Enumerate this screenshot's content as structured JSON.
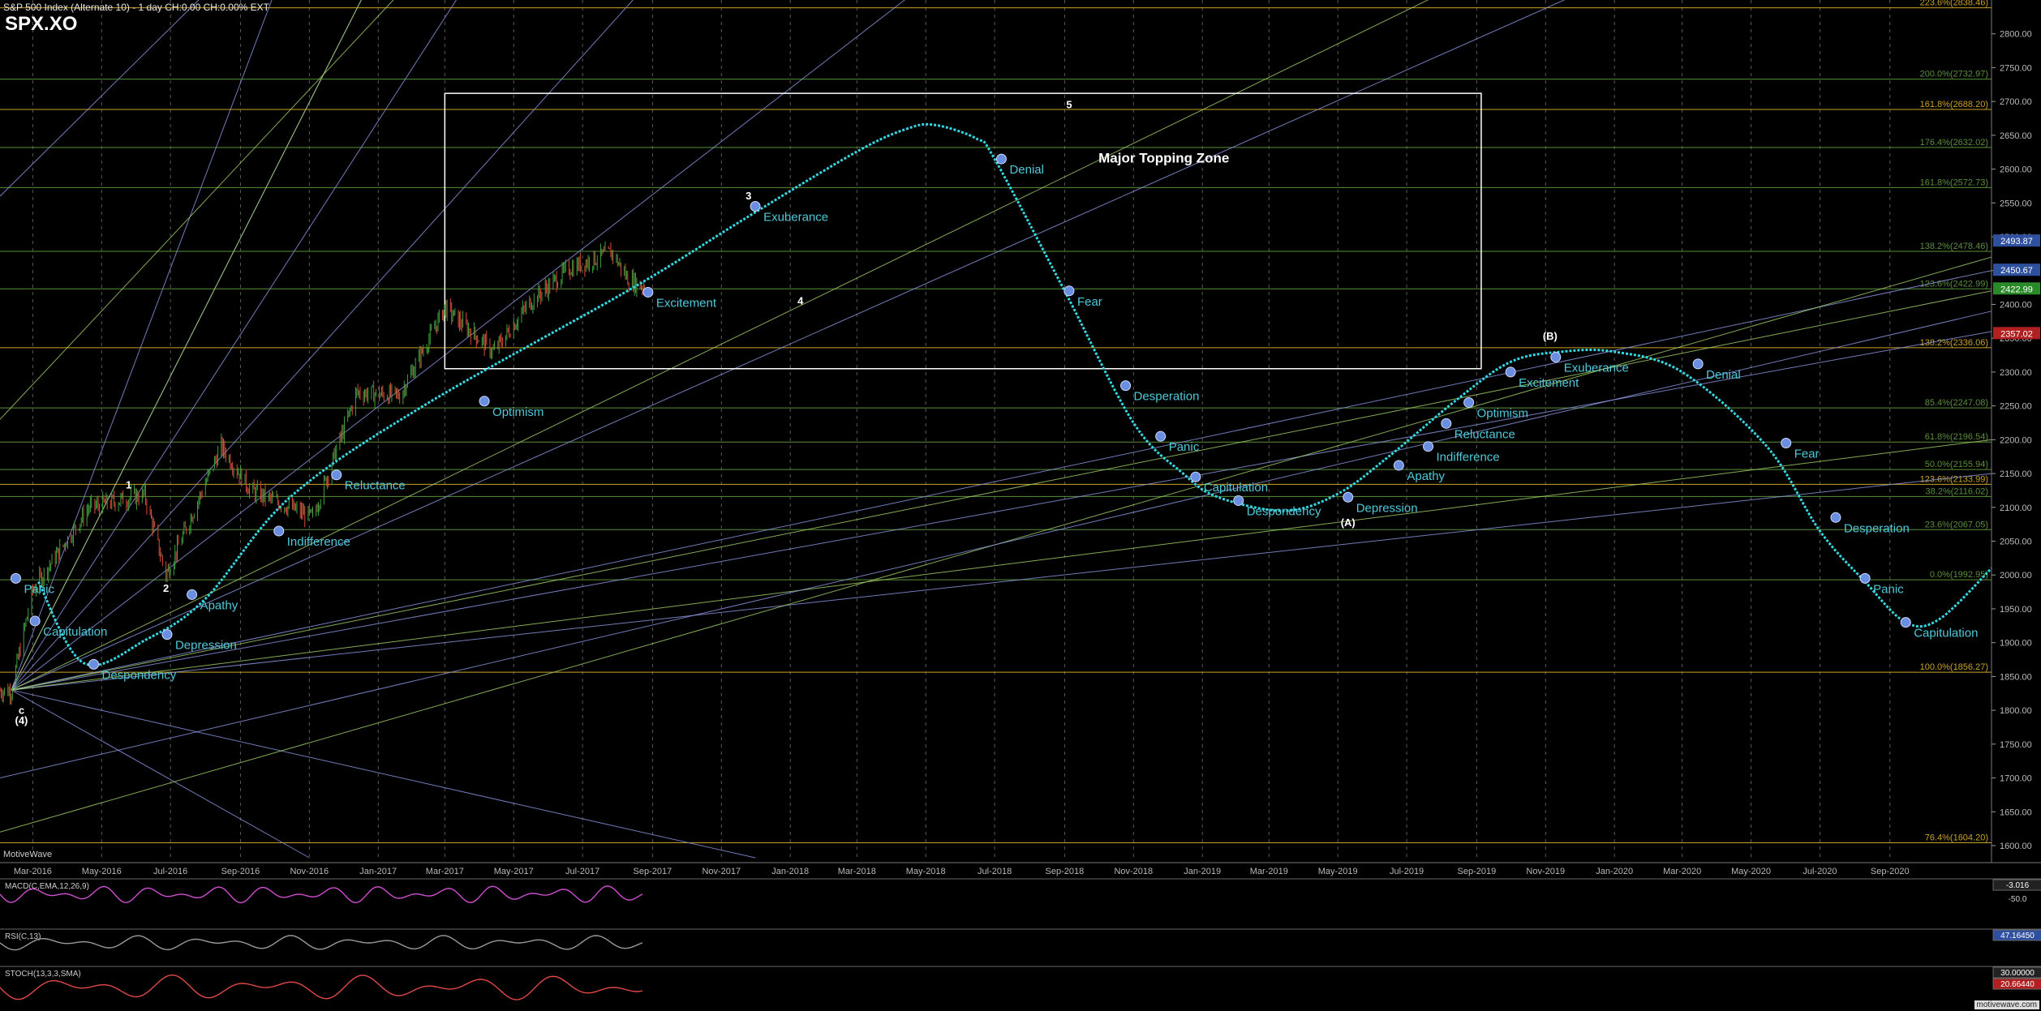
{
  "header": {
    "title": "S&P 500 Index (Alternate 10) - 1 day",
    "change": "CH:0.00",
    "change_pct": "CH:0.00%",
    "session": "EXT",
    "symbol": "SPX.XO"
  },
  "footer": {
    "source": "MotiveWave",
    "watermark": "motivewave.com"
  },
  "colors": {
    "background": "#000000",
    "projection": "#35d6e0",
    "fib_green": "#5a8f3a",
    "fib_gold": "#c9a227",
    "fan_blue": "#8f9be6",
    "fan_green": "#a6d66b",
    "price_green": "#3fa340",
    "price_red": "#d94a3a",
    "label_cyan": "#4fc9d9",
    "box": "#ffffff"
  },
  "chart_data": {
    "type": "line",
    "title": "S&P 500 Index (Alternate 10) - 1 day",
    "y_ticks": [
      "1600.00",
      "1650.00",
      "1700.00",
      "1750.00",
      "1800.00",
      "1850.00",
      "1900.00",
      "1950.00",
      "2000.00",
      "2050.00",
      "2100.00",
      "2150.00",
      "2200.00",
      "2250.00",
      "2300.00",
      "2350.00",
      "2400.00",
      "2450.00",
      "2500.00",
      "2550.00",
      "2600.00",
      "2650.00",
      "2700.00",
      "2750.00",
      "2800.00"
    ],
    "ylim": [
      1582,
      2850
    ],
    "x_ticks": [
      "Mar-2016",
      "May-2016",
      "Jul-2016",
      "Sep-2016",
      "Nov-2016",
      "Jan-2017",
      "Mar-2017",
      "May-2017",
      "Jul-2017",
      "Sep-2017",
      "Nov-2017",
      "Jan-2018",
      "Mar-2018",
      "May-2018",
      "Jul-2018",
      "Sep-2018",
      "Nov-2018",
      "Jan-2019",
      "Mar-2019",
      "May-2019",
      "Jul-2019",
      "Sep-2019",
      "Nov-2019",
      "Jan-2020",
      "Mar-2020",
      "May-2020",
      "Jul-2020",
      "Sep-2020"
    ],
    "fib_levels": [
      {
        "label": "223.6%(2838.46)",
        "value": 2838.46,
        "color": "gold"
      },
      {
        "label": "200.0%(2732.97)",
        "value": 2732.97,
        "color": "green"
      },
      {
        "label": "161.8%(2688.20)",
        "value": 2688.2,
        "color": "gold"
      },
      {
        "label": "176.4%(2632.02)",
        "value": 2632.02,
        "color": "green"
      },
      {
        "label": "161.8%(2572.73)",
        "value": 2572.73,
        "color": "green"
      },
      {
        "label": "138.2%(2478.46)",
        "value": 2478.46,
        "color": "green"
      },
      {
        "label": "123.6%(2422.99)",
        "value": 2422.99,
        "color": "green"
      },
      {
        "label": "138.2%(2336.06)",
        "value": 2336.06,
        "color": "gold"
      },
      {
        "label": "85.4%(2247.08)",
        "value": 2247.08,
        "color": "green"
      },
      {
        "label": "61.8%(2196.54)",
        "value": 2196.54,
        "color": "green"
      },
      {
        "label": "50.0%(2155.94)",
        "value": 2155.94,
        "color": "green"
      },
      {
        "label": "123.6%(2133.99)",
        "value": 2133.99,
        "color": "gold"
      },
      {
        "label": "38.2%(2116.02)",
        "value": 2116.02,
        "color": "green"
      },
      {
        "label": "23.6%(2067.05)",
        "value": 2067.05,
        "color": "green"
      },
      {
        "label": "0.0%(1992.95)",
        "value": 1992.95,
        "color": "green"
      },
      {
        "label": "100.0%(1856.27)",
        "value": 1856.27,
        "color": "gold"
      },
      {
        "label": "76.4%(1604.20)",
        "value": 1604.2,
        "color": "gold"
      }
    ],
    "price_tags": [
      {
        "label": "2493.87",
        "value": 2493.87,
        "color": "#2f4f9f"
      },
      {
        "label": "2450.67",
        "value": 2450.67,
        "color": "#2f4f9f"
      },
      {
        "label": "2422.99",
        "value": 2422.99,
        "color": "#2a8a2a"
      },
      {
        "label": "2357.02",
        "value": 2357.02,
        "color": "#b02020"
      }
    ],
    "projection": {
      "name": "Sentiment cycle projection",
      "x_date": [
        "2016-03-06",
        "2016-04-15",
        "2016-06-10",
        "2016-08-01",
        "2016-10-15",
        "2017-02-10",
        "2017-08-15",
        "2017-11-20",
        "2018-02-28",
        "2018-04-15",
        "2018-05-10",
        "2018-06-15",
        "2018-07-01",
        "2018-09-01",
        "2018-11-01",
        "2018-12-15",
        "2019-01-15",
        "2019-03-15",
        "2019-05-01",
        "2019-06-15",
        "2019-08-15",
        "2019-10-01",
        "2019-11-15",
        "2020-01-01",
        "2020-03-01",
        "2020-05-15",
        "2020-07-01",
        "2020-08-10",
        "2020-09-15",
        "2020-10-15",
        "2020-11-30"
      ],
      "y": [
        1990,
        1870,
        1905,
        1965,
        2115,
        2250,
        2425,
        2525,
        2625,
        2660,
        2665,
        2645,
        2615,
        2420,
        2225,
        2150,
        2115,
        2095,
        2120,
        2175,
        2260,
        2315,
        2330,
        2330,
        2300,
        2190,
        2065,
        1990,
        1930,
        1935,
        2010
      ]
    },
    "cycle_markers": [
      {
        "label": "Panic",
        "date": "2016-02-15",
        "value": 1995
      },
      {
        "label": "Capitulation",
        "date": "2016-03-03",
        "value": 1932
      },
      {
        "label": "Despondency",
        "date": "2016-04-24",
        "value": 1868
      },
      {
        "label": "Depression",
        "date": "2016-06-28",
        "value": 1912
      },
      {
        "label": "Apathy",
        "date": "2016-07-20",
        "value": 1971
      },
      {
        "label": "Indifference",
        "date": "2016-10-05",
        "value": 2065
      },
      {
        "label": "Reluctance",
        "date": "2016-11-25",
        "value": 2148
      },
      {
        "label": "Optimism",
        "date": "2017-04-05",
        "value": 2257
      },
      {
        "label": "Excitement",
        "date": "2017-08-28",
        "value": 2418
      },
      {
        "label": "Exuberance",
        "date": "2017-12-01",
        "value": 2545
      },
      {
        "label": "Denial",
        "date": "2018-07-07",
        "value": 2615
      },
      {
        "label": "Fear",
        "date": "2018-09-05",
        "value": 2420
      },
      {
        "label": "Desperation",
        "date": "2018-10-25",
        "value": 2280
      },
      {
        "label": "Panic",
        "date": "2018-11-25",
        "value": 2205
      },
      {
        "label": "Capitulation",
        "date": "2018-12-26",
        "value": 2145
      },
      {
        "label": "Despondency",
        "date": "2019-02-02",
        "value": 2110
      },
      {
        "label": "Depression",
        "date": "2019-05-10",
        "value": 2115
      },
      {
        "label": "Apathy",
        "date": "2019-06-24",
        "value": 2162
      },
      {
        "label": "Indifference",
        "date": "2019-07-20",
        "value": 2190
      },
      {
        "label": "Reluctance",
        "date": "2019-08-05",
        "value": 2224
      },
      {
        "label": "Optimism",
        "date": "2019-08-25",
        "value": 2255
      },
      {
        "label": "Excitement",
        "date": "2019-10-01",
        "value": 2300
      },
      {
        "label": "Exuberance",
        "date": "2019-11-10",
        "value": 2322
      },
      {
        "label": "Denial",
        "date": "2020-03-15",
        "value": 2312
      },
      {
        "label": "Fear",
        "date": "2020-06-01",
        "value": 2195
      },
      {
        "label": "Desperation",
        "date": "2020-07-15",
        "value": 2085
      },
      {
        "label": "Panic",
        "date": "2020-08-10",
        "value": 1995
      },
      {
        "label": "Capitulation",
        "date": "2020-09-15",
        "value": 1930
      }
    ],
    "wave_labels": [
      {
        "label": "1",
        "date": "2016-05-25",
        "value": 2128
      },
      {
        "label": "2",
        "date": "2016-06-27",
        "value": 1975
      },
      {
        "label": "3",
        "date": "2017-11-25",
        "value": 2555
      },
      {
        "label": "4",
        "date": "2018-01-10",
        "value": 2400
      },
      {
        "label": "5",
        "date": "2018-09-05",
        "value": 2690
      },
      {
        "label": "(A)",
        "date": "2019-05-10",
        "value": 2072
      },
      {
        "label": "(B)",
        "date": "2019-11-05",
        "value": 2348
      },
      {
        "label": "(4)",
        "date": "2016-02-20",
        "value": 1780
      },
      {
        "label": "c",
        "date": "2016-02-20",
        "value": 1795
      }
    ],
    "annotation": {
      "label": "Major Topping Zone",
      "box_x": [
        "2017-03-01",
        "2019-09-05"
      ],
      "box_y": [
        2305,
        2712
      ]
    },
    "candles": {
      "start": "2016-02-01",
      "end": "2017-08-25",
      "anchors_date": [
        "2016-02-11",
        "2016-03-01",
        "2016-04-20",
        "2016-06-08",
        "2016-06-27",
        "2016-08-15",
        "2016-09-10",
        "2016-11-04",
        "2016-12-13",
        "2017-01-20",
        "2017-03-01",
        "2017-04-13",
        "2017-05-15",
        "2017-06-19",
        "2017-07-27",
        "2017-08-10",
        "2017-08-21"
      ],
      "anchors_close": [
        1829,
        1978,
        2100,
        2119,
        2000,
        2190,
        2125,
        2085,
        2270,
        2265,
        2395,
        2330,
        2402,
        2453,
        2477,
        2438,
        2428
      ]
    },
    "fan_lines": [
      {
        "from_date": "2016-02-11",
        "from": 1830,
        "to_date": "2016-10-01",
        "to": 2860,
        "color": "blue"
      },
      {
        "from_date": "2016-02-11",
        "from": 1830,
        "to_date": "2016-12-20",
        "to": 2860,
        "color": "blue"
      },
      {
        "from_date": "2016-02-11",
        "from": 1830,
        "to_date": "2017-03-15",
        "to": 2860,
        "color": "blue"
      },
      {
        "from_date": "2016-02-11",
        "from": 1830,
        "to_date": "2017-08-20",
        "to": 2860,
        "color": "blue"
      },
      {
        "from_date": "2016-02-11",
        "from": 1830,
        "to_date": "2018-04-20",
        "to": 2860,
        "color": "blue"
      },
      {
        "from_date": "2016-02-11",
        "from": 1830,
        "to_date": "2019-12-01",
        "to": 2860,
        "color": "blue"
      },
      {
        "from_date": "2016-02-11",
        "from": 1830,
        "to_date": "2020-11-30",
        "to": 2450,
        "color": "blue"
      },
      {
        "from_date": "2016-02-11",
        "from": 1830,
        "to_date": "2020-11-30",
        "to": 2360,
        "color": "blue"
      },
      {
        "from_date": "2016-02-11",
        "from": 1830,
        "to_date": "2020-11-30",
        "to": 2150,
        "color": "blue"
      },
      {
        "from_date": "2016-02-11",
        "from": 1830,
        "to_date": "2017-12-01",
        "to": 1582,
        "color": "blue"
      },
      {
        "from_date": "2016-02-11",
        "from": 1830,
        "to_date": "2016-11-01",
        "to": 1582,
        "color": "blue"
      },
      {
        "from_date": "2016-02-11",
        "from": 1830,
        "to_date": "2016-12-20",
        "to": 2860,
        "color": "green"
      },
      {
        "from_date": "2016-02-11",
        "from": 1830,
        "to_date": "2019-08-01",
        "to": 2860,
        "color": "green"
      },
      {
        "from_date": "2016-02-11",
        "from": 1830,
        "to_date": "2020-11-30",
        "to": 2420,
        "color": "green"
      },
      {
        "from_date": "2016-02-11",
        "from": 1830,
        "to_date": "2020-11-30",
        "to": 2200,
        "color": "green"
      },
      {
        "from_date": "2016-02-01",
        "from": 2230,
        "to_date": "2017-01-20",
        "to": 2860,
        "color": "green"
      },
      {
        "from_date": "2016-02-01",
        "from": 2560,
        "to_date": "2016-08-01",
        "to": 2860,
        "color": "blue"
      },
      {
        "from_date": "2016-02-01",
        "from": 1620,
        "to_date": "2020-11-30",
        "to": 2470,
        "color": "green"
      },
      {
        "from_date": "2016-02-01",
        "from": 1700,
        "to_date": "2020-11-30",
        "to": 2390,
        "color": "blue"
      }
    ],
    "indicators": [
      {
        "name": "MACD(C,EMA,12,26,9)",
        "value": "-3.016",
        "level": "-50.0"
      },
      {
        "name": "RSI(C,13)",
        "value": "47.16450"
      },
      {
        "name": "STOCH(13,3,3,SMA)",
        "value_a": "30.00000",
        "value_b": "20.66440"
      }
    ]
  }
}
